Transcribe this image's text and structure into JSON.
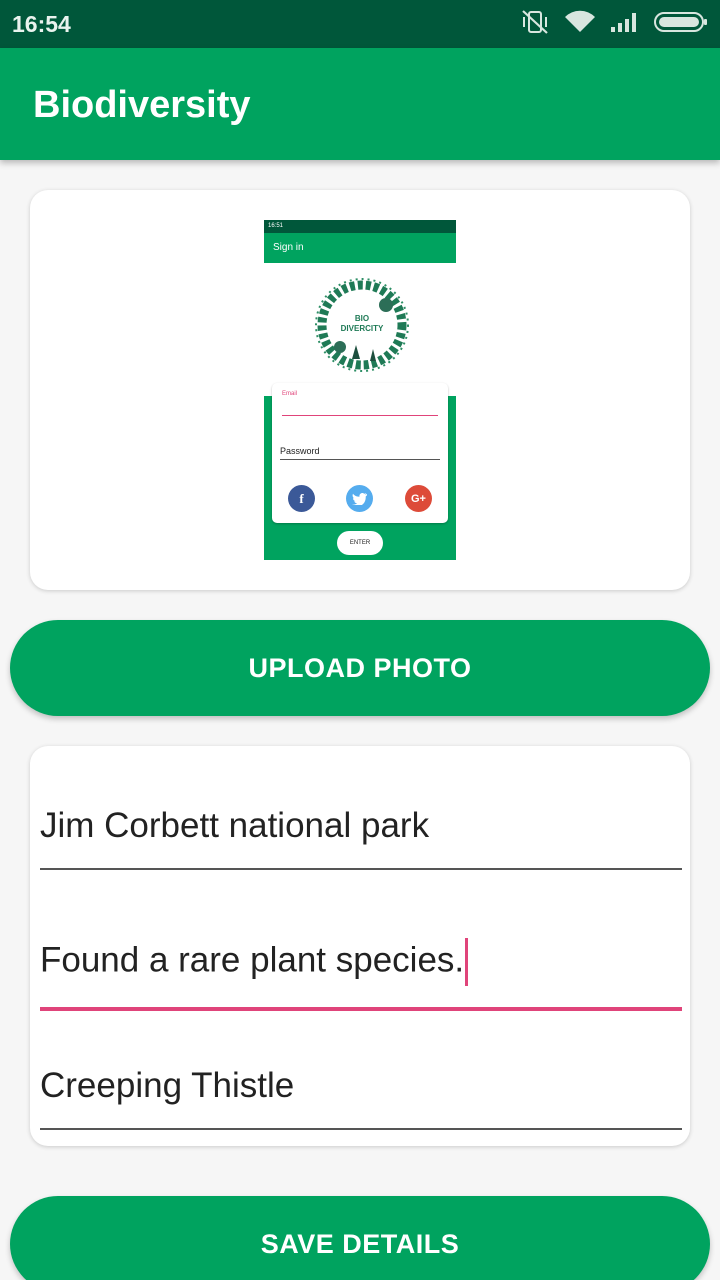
{
  "status_bar": {
    "time": "16:54",
    "icons": [
      "vibrate-off-icon",
      "wifi-icon",
      "signal-icon",
      "battery-icon"
    ]
  },
  "app_bar": {
    "title": "Biodiversity"
  },
  "photo_preview": {
    "status_time": "16:51",
    "app_title": "Sign in",
    "logo_text_line1": "BIO",
    "logo_text_line2": "DIVERCITY",
    "email_label": "Email",
    "password_label": "Password",
    "social": [
      "facebook-icon",
      "twitter-icon",
      "google-plus-icon"
    ],
    "social_glyphs": {
      "facebook": "f",
      "google": "G+"
    },
    "enter_label": "ENTER"
  },
  "buttons": {
    "upload": "UPLOAD PHOTO",
    "save": "SAVE DETAILS"
  },
  "form": {
    "location_value": "Jim Corbett national park",
    "description_value": "Found a rare plant species.",
    "species_value": "Creeping Thistle"
  },
  "colors": {
    "primary": "#00a35f",
    "primary_dark": "#00573a",
    "accent": "#e0447a"
  }
}
